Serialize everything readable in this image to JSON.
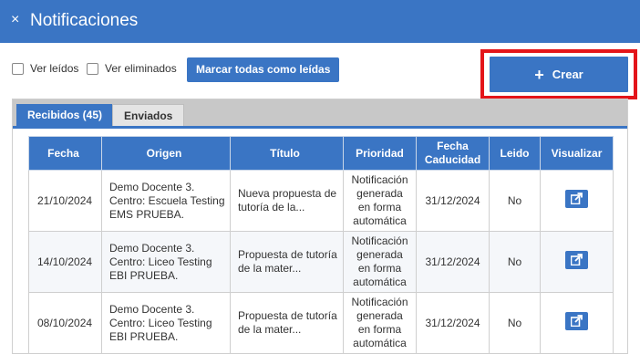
{
  "window": {
    "title": "Notificaciones",
    "close_symbol": "×"
  },
  "toolbar": {
    "ver_leidos": "Ver leídos",
    "ver_eliminados": "Ver eliminados",
    "marcar_todas": "Marcar todas como leídas",
    "crear_label": "Crear",
    "crear_symbol": "+"
  },
  "tabs": [
    {
      "label": "Recibidos (45)",
      "active": true
    },
    {
      "label": "Enviados",
      "active": false
    }
  ],
  "table": {
    "headers": [
      "Fecha",
      "Origen",
      "Título",
      "Prioridad",
      "Fecha Caducidad",
      "Leido",
      "Visualizar"
    ],
    "rows": [
      {
        "fecha": "21/10/2024",
        "origen": [
          "Demo Docente 3.",
          "Centro: Escuela Testing",
          "EMS PRUEBA."
        ],
        "titulo": [
          "Nueva propuesta de",
          "tutoría de la..."
        ],
        "prioridad": [
          "Notificación",
          "generada",
          "en forma",
          "automática"
        ],
        "caducidad": "31/12/2024",
        "leido": "No"
      },
      {
        "fecha": "14/10/2024",
        "origen": [
          "Demo Docente 3.",
          "Centro: Liceo Testing",
          "EBI PRUEBA."
        ],
        "titulo": [
          "Propuesta de tutoría",
          "de la mater..."
        ],
        "prioridad": [
          "Notificación",
          "generada",
          "en forma",
          "automática"
        ],
        "caducidad": "31/12/2024",
        "leido": "No"
      },
      {
        "fecha": "08/10/2024",
        "origen": [
          "Demo Docente 3.",
          "Centro: Liceo Testing",
          "EBI PRUEBA."
        ],
        "titulo": [
          "Propuesta de tutoría",
          "de la mater..."
        ],
        "prioridad": [
          "Notificación",
          "generada",
          "en forma",
          "automática"
        ],
        "caducidad": "31/12/2024",
        "leido": "No"
      }
    ]
  },
  "colors": {
    "primary": "#3a75c4",
    "highlight": "#e3151a",
    "tabbar": "#c8c8c8"
  },
  "icons": {
    "close": "close-icon",
    "add": "plus-icon",
    "view": "external-link-icon"
  }
}
